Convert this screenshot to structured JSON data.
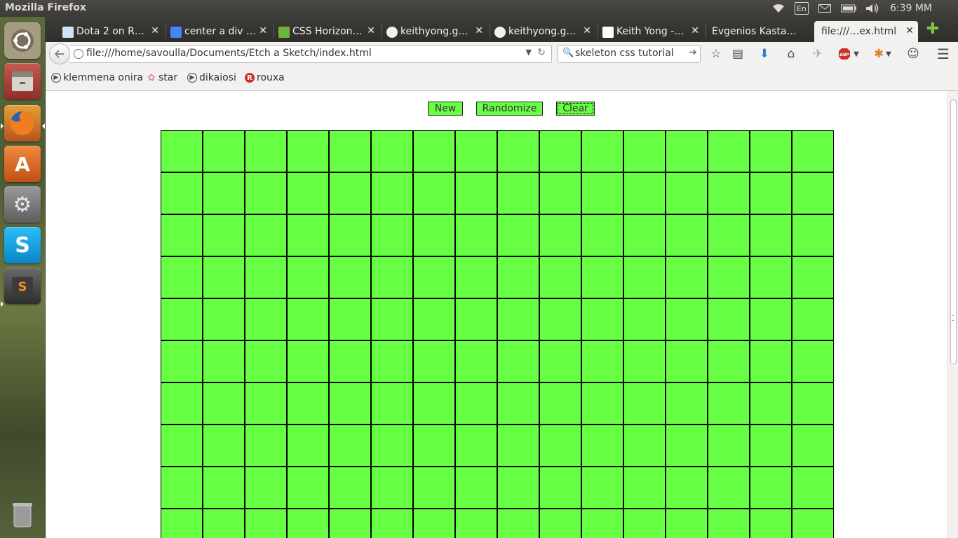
{
  "system": {
    "app_title": "Mozilla Firefox",
    "language_indicator": "En",
    "clock": "6:39 MM",
    "indicators": [
      "wifi-icon",
      "keyboard-layout",
      "mail-icon",
      "battery-icon",
      "volume-icon"
    ]
  },
  "launcher": {
    "items": [
      {
        "name": "ubuntu-dash",
        "glyph": "◎",
        "color": "#c9c0a8"
      },
      {
        "name": "files",
        "glyph": "▭",
        "color": "#b24b44"
      },
      {
        "name": "firefox",
        "glyph": "●",
        "color": "#e46a1e"
      },
      {
        "name": "software-center",
        "glyph": "A",
        "color": "#e5742a"
      },
      {
        "name": "system-settings",
        "glyph": "⚙",
        "color": "#8d8d8d"
      },
      {
        "name": "skype",
        "glyph": "S",
        "color": "#00aff0"
      },
      {
        "name": "sublime-text",
        "glyph": "S",
        "color": "#4a4a4a"
      },
      {
        "name": "trash",
        "glyph": "🗑",
        "color": "#8c8c8c"
      }
    ]
  },
  "tabs": [
    {
      "title": "Dota 2 on R…",
      "favicon_color": "#cee3f8"
    },
    {
      "title": "center a div …",
      "favicon_color": "#4285f4"
    },
    {
      "title": "CSS Horizon…",
      "favicon_color": "#6fb43f"
    },
    {
      "title": "keithyong.g…",
      "favicon_color": "#333333"
    },
    {
      "title": "keithyong.g…",
      "favicon_color": "#333333"
    },
    {
      "title": "Keith Yong -…",
      "favicon_color": "#ffffff"
    },
    {
      "title": "Evgenios Kasta…",
      "favicon_color": ""
    },
    {
      "title": "file:///…ex.html",
      "favicon_color": "",
      "active": true
    }
  ],
  "navbar": {
    "url": "file:///home/savoulla/Documents/Etch a Sketch/index.html",
    "search_value": "skeleton css tutorial"
  },
  "bookmarks": [
    {
      "label": "klemmena onira",
      "icon": "play-circle-icon"
    },
    {
      "label": "star",
      "icon": "flower-icon"
    },
    {
      "label": "dikaiosi",
      "icon": "play-circle-icon"
    },
    {
      "label": "rouxa",
      "icon": "r-circle-icon"
    }
  ],
  "page": {
    "buttons": {
      "new_label": "New",
      "randomize_label": "Randomize",
      "clear_label": "Clear"
    },
    "grid": {
      "columns": 16,
      "visible_rows": 10,
      "cell_color": "#66ff44",
      "border_color": "#000000"
    }
  },
  "colors": {
    "accent_green": "#66ff44",
    "panel_dark": "#3c3b37",
    "chrome_light": "#f2f1f0"
  }
}
